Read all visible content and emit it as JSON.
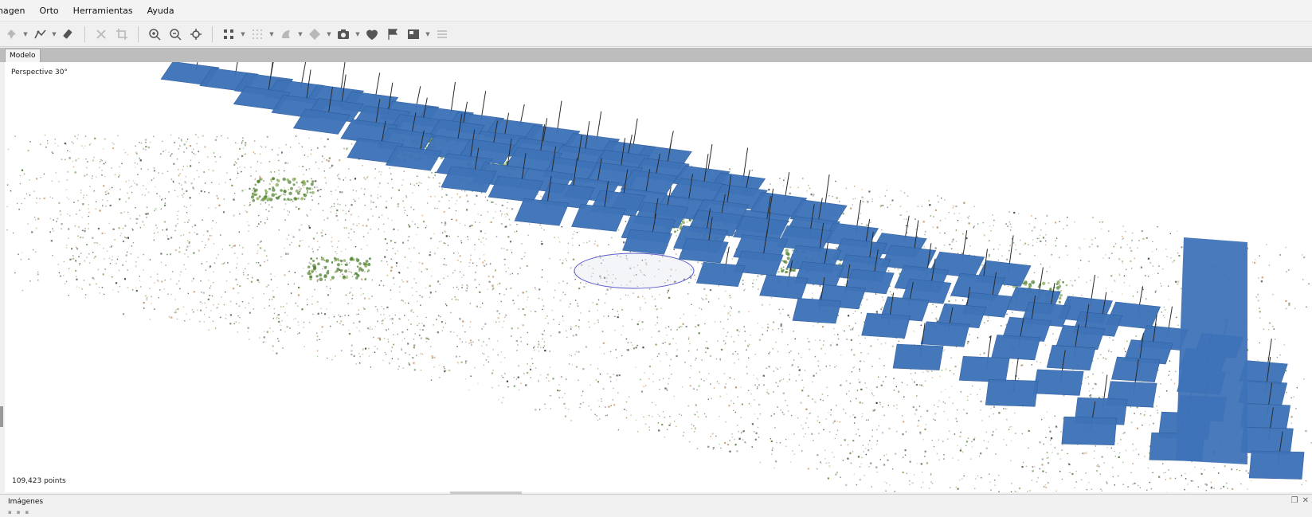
{
  "menu": [
    "nagen",
    "Orto",
    "Herramientas",
    "Ayuda"
  ],
  "toolbar": {
    "items": [
      {
        "icon": "pin-icon",
        "dim": true,
        "caret": true
      },
      {
        "icon": "polyline-icon",
        "dim": false,
        "caret": true
      },
      {
        "icon": "eraser-icon",
        "dim": false,
        "caret": false
      },
      {
        "sep": true
      },
      {
        "icon": "delete-x-icon",
        "dim": true,
        "caret": false
      },
      {
        "icon": "crop-icon",
        "dim": true,
        "caret": false
      },
      {
        "sep": true
      },
      {
        "icon": "zoom-in-icon",
        "dim": false,
        "caret": false
      },
      {
        "icon": "zoom-out-icon",
        "dim": false,
        "caret": false
      },
      {
        "icon": "move-center-icon",
        "dim": false,
        "caret": false
      },
      {
        "sep": true
      },
      {
        "icon": "grid-points-icon",
        "dim": false,
        "caret": true
      },
      {
        "icon": "grid-dots-icon",
        "dim": true,
        "caret": true
      },
      {
        "icon": "shape-icon",
        "dim": true,
        "caret": true
      },
      {
        "icon": "diamond-icon",
        "dim": true,
        "caret": true
      },
      {
        "icon": "camera-icon",
        "dim": false,
        "caret": true
      },
      {
        "icon": "shield-icon",
        "dim": false,
        "caret": false
      },
      {
        "icon": "flag-icon",
        "dim": false,
        "caret": false
      },
      {
        "icon": "image-icon",
        "dim": false,
        "caret": true
      },
      {
        "icon": "list-icon",
        "dim": true,
        "caret": false
      }
    ]
  },
  "tabs": {
    "model": "Modelo"
  },
  "viewport": {
    "perspective_label": "Perspective 30°",
    "points_label": "109,423 points"
  },
  "panel": {
    "title": "Imágenes"
  },
  "colors": {
    "camera_plane": "#3e73b8",
    "camera_plane_edge": "#2f5e9d",
    "background": "#ffffff"
  }
}
